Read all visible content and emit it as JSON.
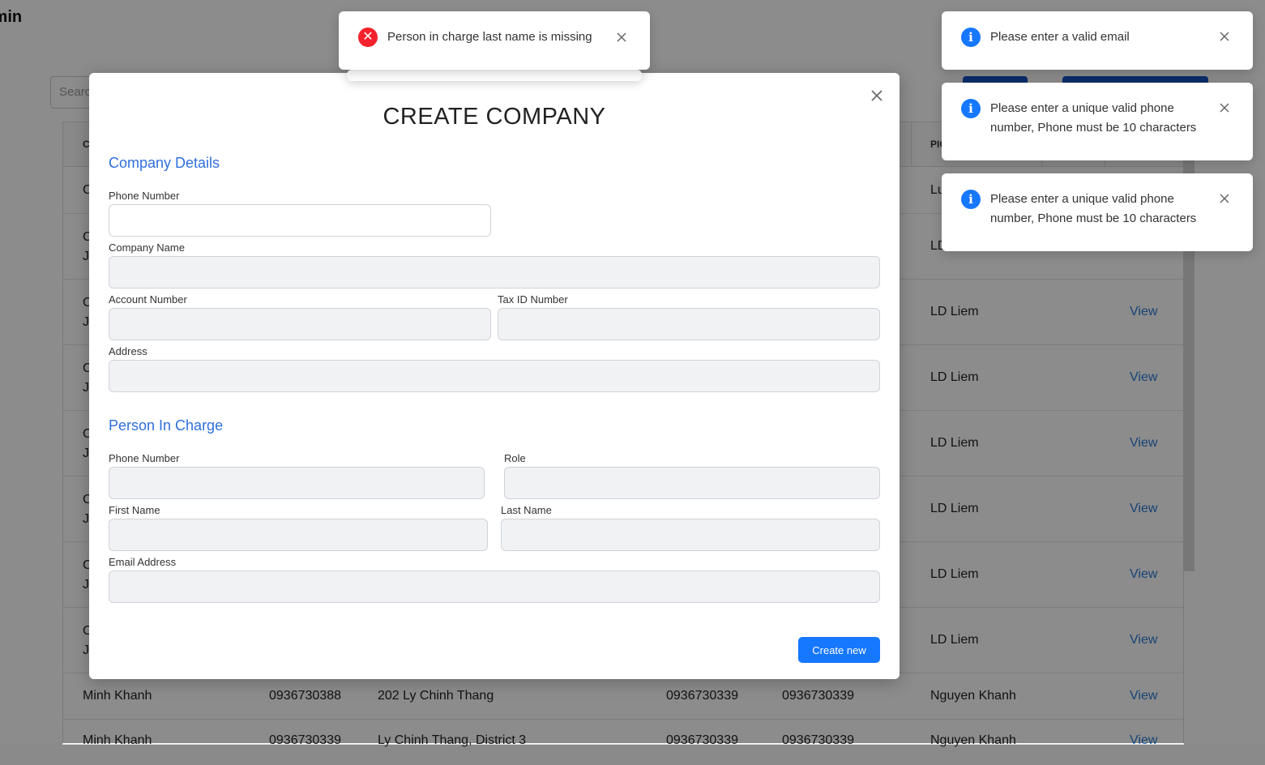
{
  "background": {
    "page_title": "lmin",
    "search_placeholder": "Search",
    "header_cols": [
      "C",
      "PIC"
    ],
    "rows": [
      {
        "name": "C",
        "pic": "Lu"
      },
      {
        "name": "C",
        "name2": "Jo",
        "pic": "LD"
      },
      {
        "name": "C",
        "name2": "Jo",
        "pic": "LD Liem",
        "view": "View"
      },
      {
        "name": "C",
        "name2": "Jo",
        "pic": "LD Liem",
        "view": "View"
      },
      {
        "name": "C",
        "name2": "Jo",
        "pic": "LD Liem",
        "view": "View"
      },
      {
        "name": "C",
        "name2": "Jo",
        "pic": "LD Liem",
        "view": "View"
      },
      {
        "name": "C",
        "name2": "Jo",
        "pic": "LD Liem",
        "view": "View"
      },
      {
        "name": "C",
        "name2": "Jo",
        "pic": "LD Liem",
        "view": "View"
      },
      {
        "name": "Minh Khanh",
        "phone": "0936730388",
        "address": "202 Ly Chinh Thang",
        "tax": "0936730339",
        "pic_phone": "0936730339",
        "pic": "Nguyen Khanh",
        "view": "View"
      },
      {
        "name": "Minh Khanh",
        "phone": "0936730339",
        "address": "Ly Chinh Thang, District 3",
        "tax": "0936730339",
        "pic_phone": "0936730339",
        "pic": "Nguyen Khanh",
        "view": "View"
      }
    ]
  },
  "modal": {
    "title": "CREATE COMPANY",
    "company_section": "Company Details",
    "company_phone_label": "Phone Number",
    "company_name_label": "Company Name",
    "account_number_label": "Account Number",
    "tax_id_label": "Tax ID Number",
    "address_label": "Address",
    "pic_section": "Person In Charge",
    "pic_phone_label": "Phone Number",
    "role_label": "Role",
    "first_name_label": "First Name",
    "last_name_label": "Last Name",
    "email_label": "Email Address",
    "submit_label": "Create new"
  },
  "toasts": {
    "error": {
      "text": "Person in charge last name is missing",
      "icon": "error-x-icon",
      "color": "#f5222d"
    },
    "info": [
      {
        "text": "Please enter a valid email",
        "icon": "info-icon",
        "color": "#1677ff"
      },
      {
        "text": "Please enter a unique valid phone number, Phone must be 10 characters",
        "icon": "info-icon",
        "color": "#1677ff"
      },
      {
        "text": "Please enter a unique valid phone number, Phone must be 10 characters",
        "icon": "info-icon",
        "color": "#1677ff"
      }
    ]
  }
}
